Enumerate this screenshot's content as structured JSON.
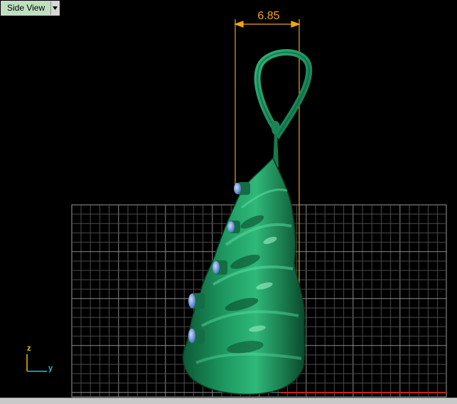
{
  "viewport": {
    "view_name": "Side View"
  },
  "dimension": {
    "value": "6.85",
    "color": "#f0a418"
  },
  "axes": {
    "z_label": "z",
    "y_label": "y",
    "z_color": "#e8c000",
    "y_color": "#38b4d8"
  },
  "model": {
    "color": "#1e8a5a",
    "gem_color": "#7fa9e6"
  },
  "icons": {
    "view_dropdown": "chevron-down-icon"
  }
}
